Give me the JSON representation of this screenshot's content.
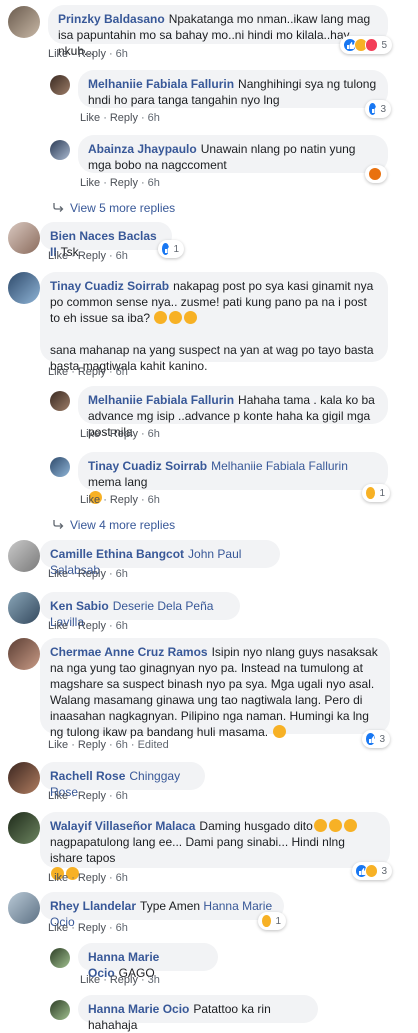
{
  "colors": {
    "link": "#385898",
    "bubble": "#f2f3f5",
    "meta": "#606770",
    "like": "#1877f2",
    "haha": "#f7b125",
    "love": "#f33e58",
    "angry": "#e9710f"
  },
  "actions": {
    "like": "Like",
    "reply": "Reply",
    "dot": "·"
  },
  "comments": [
    {
      "author": "Prinzky Baldasano",
      "text": "Npakatanga mo nman..ikaw lang mag isa papuntahin mo sa bahay mo..ni hindi mo kilala..hay nkuh...",
      "time": "6h",
      "reactions": [
        "like",
        "haha",
        "love"
      ],
      "count": "5"
    },
    {
      "author": "Melhaniie Fabiala Fallurin",
      "text": "Nanghihingi sya ng tulong hndi ho para tanga tangahin nyo lng",
      "time": "6h",
      "reactions": [
        "like"
      ],
      "count": "3"
    },
    {
      "author": "Abainza Jhaypaulo",
      "text": "Unawain nlang po natin yung mga bobo na nagccoment",
      "time": "6h",
      "reactions": [
        "angry"
      ],
      "count": ""
    },
    {
      "author": "Bien Naces Baclas II",
      "text": "Tsk",
      "time": "6h",
      "reactions": [
        "like"
      ],
      "count": "1"
    },
    {
      "author": "Tinay Cuadiz Soirrab",
      "text": "nakapag post po sya kasi ginamit nya po common sense nya.. zusme! pati kung pano pa na i post to eh issue sa iba?",
      "text2": "sana mahanap na yang suspect na yan at wag po tayo basta basta magtiwala kahit kanino.",
      "time": "6h"
    },
    {
      "author": "Melhaniie Fabiala Fallurin",
      "text": "Hahaha tama . kala ko ba advance mg isip ..advance p konte haha ka gigil mga post nila",
      "time": "6h"
    },
    {
      "author": "Tinay Cuadiz Soirrab",
      "mention": "Melhaniie Fabiala Fallurin",
      "text": "mema lang",
      "time": "6h",
      "reactions": [
        "haha"
      ],
      "count": "1"
    },
    {
      "author": "Camille Ethina Bangcot",
      "mention": "John Paul Salabsab",
      "text": "",
      "time": "6h"
    },
    {
      "author": "Ken Sabio",
      "mention": "Deserie Dela Peña Lavilla",
      "text": "",
      "time": "6h"
    },
    {
      "author": "Chermae Anne Cruz Ramos",
      "text": "Isipin nyo nlang guys nasaksak na nga yung tao ginagnyan nyo pa. Instead na tumulong at magshare sa suspect binash nyo pa sya. Mga ugali nyo asal. Walang masamang ginawa ung tao nagtiwala lang. Pero di inaasahan nagkagnyan. Pilipino nga naman. Humingi ka lng ng tulong ikaw pa bandang huli masama.",
      "time": "6h",
      "edited": "Edited",
      "reactions": [
        "like"
      ],
      "count": "3"
    },
    {
      "author": "Rachell Rose",
      "mention": "Chinggay Rose",
      "text": "",
      "time": "6h"
    },
    {
      "author": "Walayif Villaseñor Malaca",
      "text": "Daming husgado dito",
      "text2": "nagpapatulong lang ee... Dami pang sinabi... Hindi nlng ishare tapos",
      "time": "6h",
      "reactions": [
        "like",
        "haha"
      ],
      "count": "3"
    },
    {
      "author": "Rhey Llandelar",
      "text": "Type Amen",
      "mention": "Hanna Marie Ocio",
      "time": "6h",
      "reactions": [
        "haha"
      ],
      "count": "1"
    },
    {
      "author": "Hanna Marie Ocio",
      "text": "GAGO",
      "time": "3h"
    },
    {
      "author": "Hanna Marie Ocio",
      "text": "Patattoo ka rin hahahaja",
      "time": ""
    }
  ],
  "more_replies": [
    "View 5 more replies",
    "View 4 more replies"
  ]
}
